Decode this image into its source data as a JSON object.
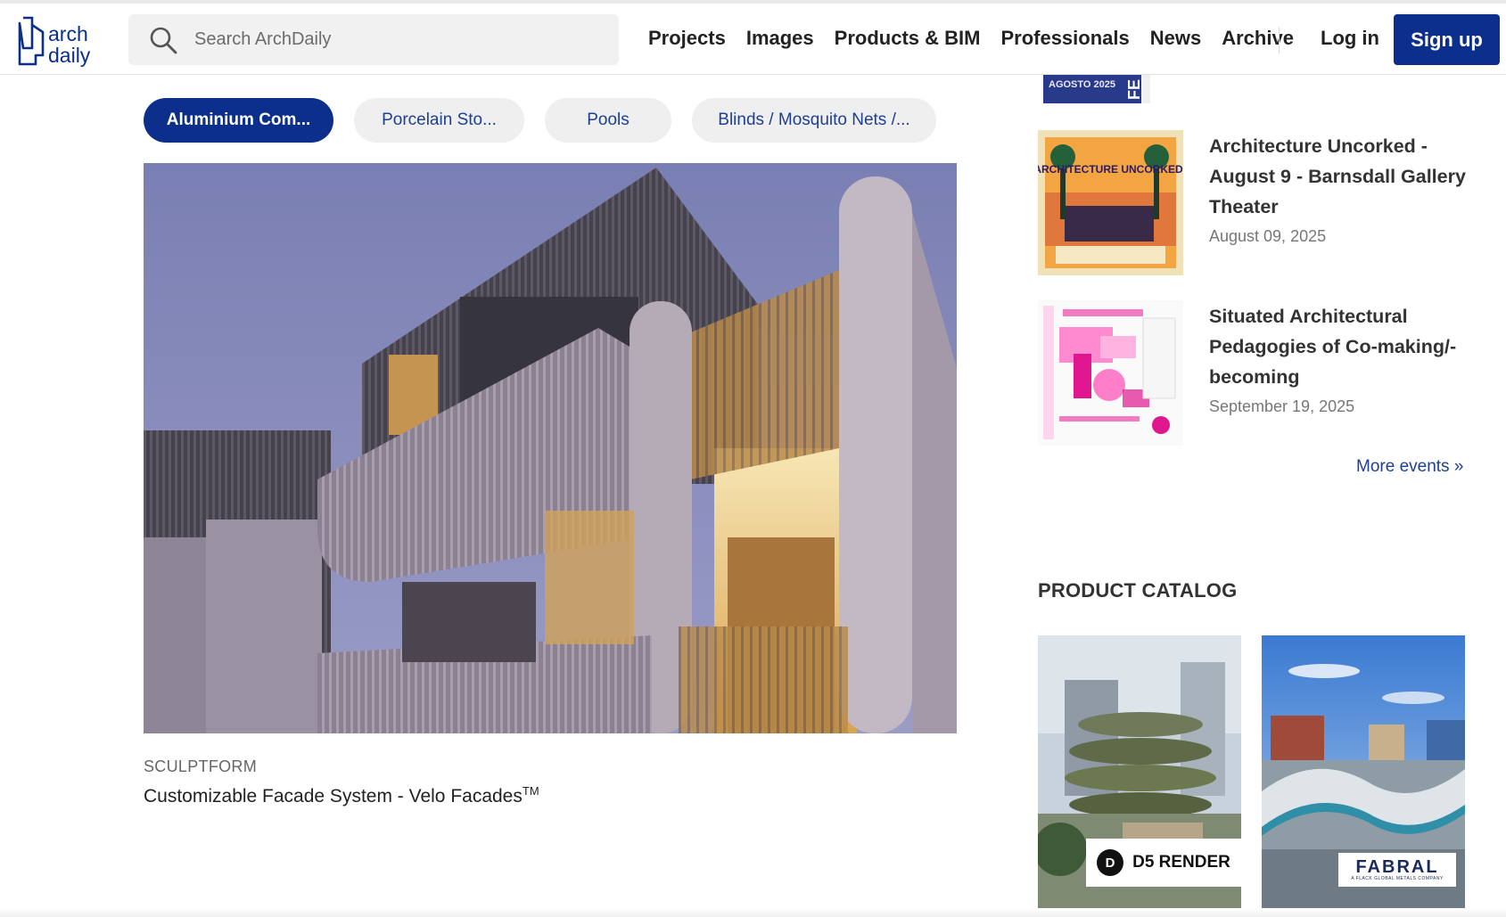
{
  "header": {
    "logo_alt": "arch daily",
    "logo_line1": "arch",
    "logo_line2": "daily",
    "search_placeholder": "Search ArchDaily",
    "nav": [
      "Projects",
      "Images",
      "Products & BIM",
      "Professionals",
      "News",
      "Archive"
    ],
    "login": "Log in",
    "signup": "Sign up",
    "brand_color": "#0b2f8a"
  },
  "filters": [
    {
      "label": "Aluminium Com...",
      "active": true
    },
    {
      "label": "Porcelain Sto...",
      "active": false
    },
    {
      "label": "Pools",
      "active": false
    },
    {
      "label": "Blinds / Mosquito Nets /...",
      "active": false
    }
  ],
  "product": {
    "brand": "SCULPTFORM",
    "title": "Customizable Facade System - Velo Facades",
    "title_tm": "TM"
  },
  "events": [
    {
      "title": "Architecture Uncorked - August 9 - Barnsdall Gallery Theater",
      "date": "August 09, 2025",
      "thumb_text": "ARCHITECTURE UNCORKED!"
    },
    {
      "title": "Situated Architectural Pedagogies of Co-making/-becoming",
      "date": "September 19, 2025"
    }
  ],
  "top_event_thumb_text": "AGOSTO 2025",
  "more_events": "More events »",
  "catalog": {
    "heading": "PRODUCT CATALOG",
    "items": [
      {
        "badge": "D5 RENDER",
        "badge_logo": "D"
      },
      {
        "badge": "FABRAL",
        "badge_sub": "A FLACK GLOBAL METALS COMPANY"
      }
    ]
  }
}
